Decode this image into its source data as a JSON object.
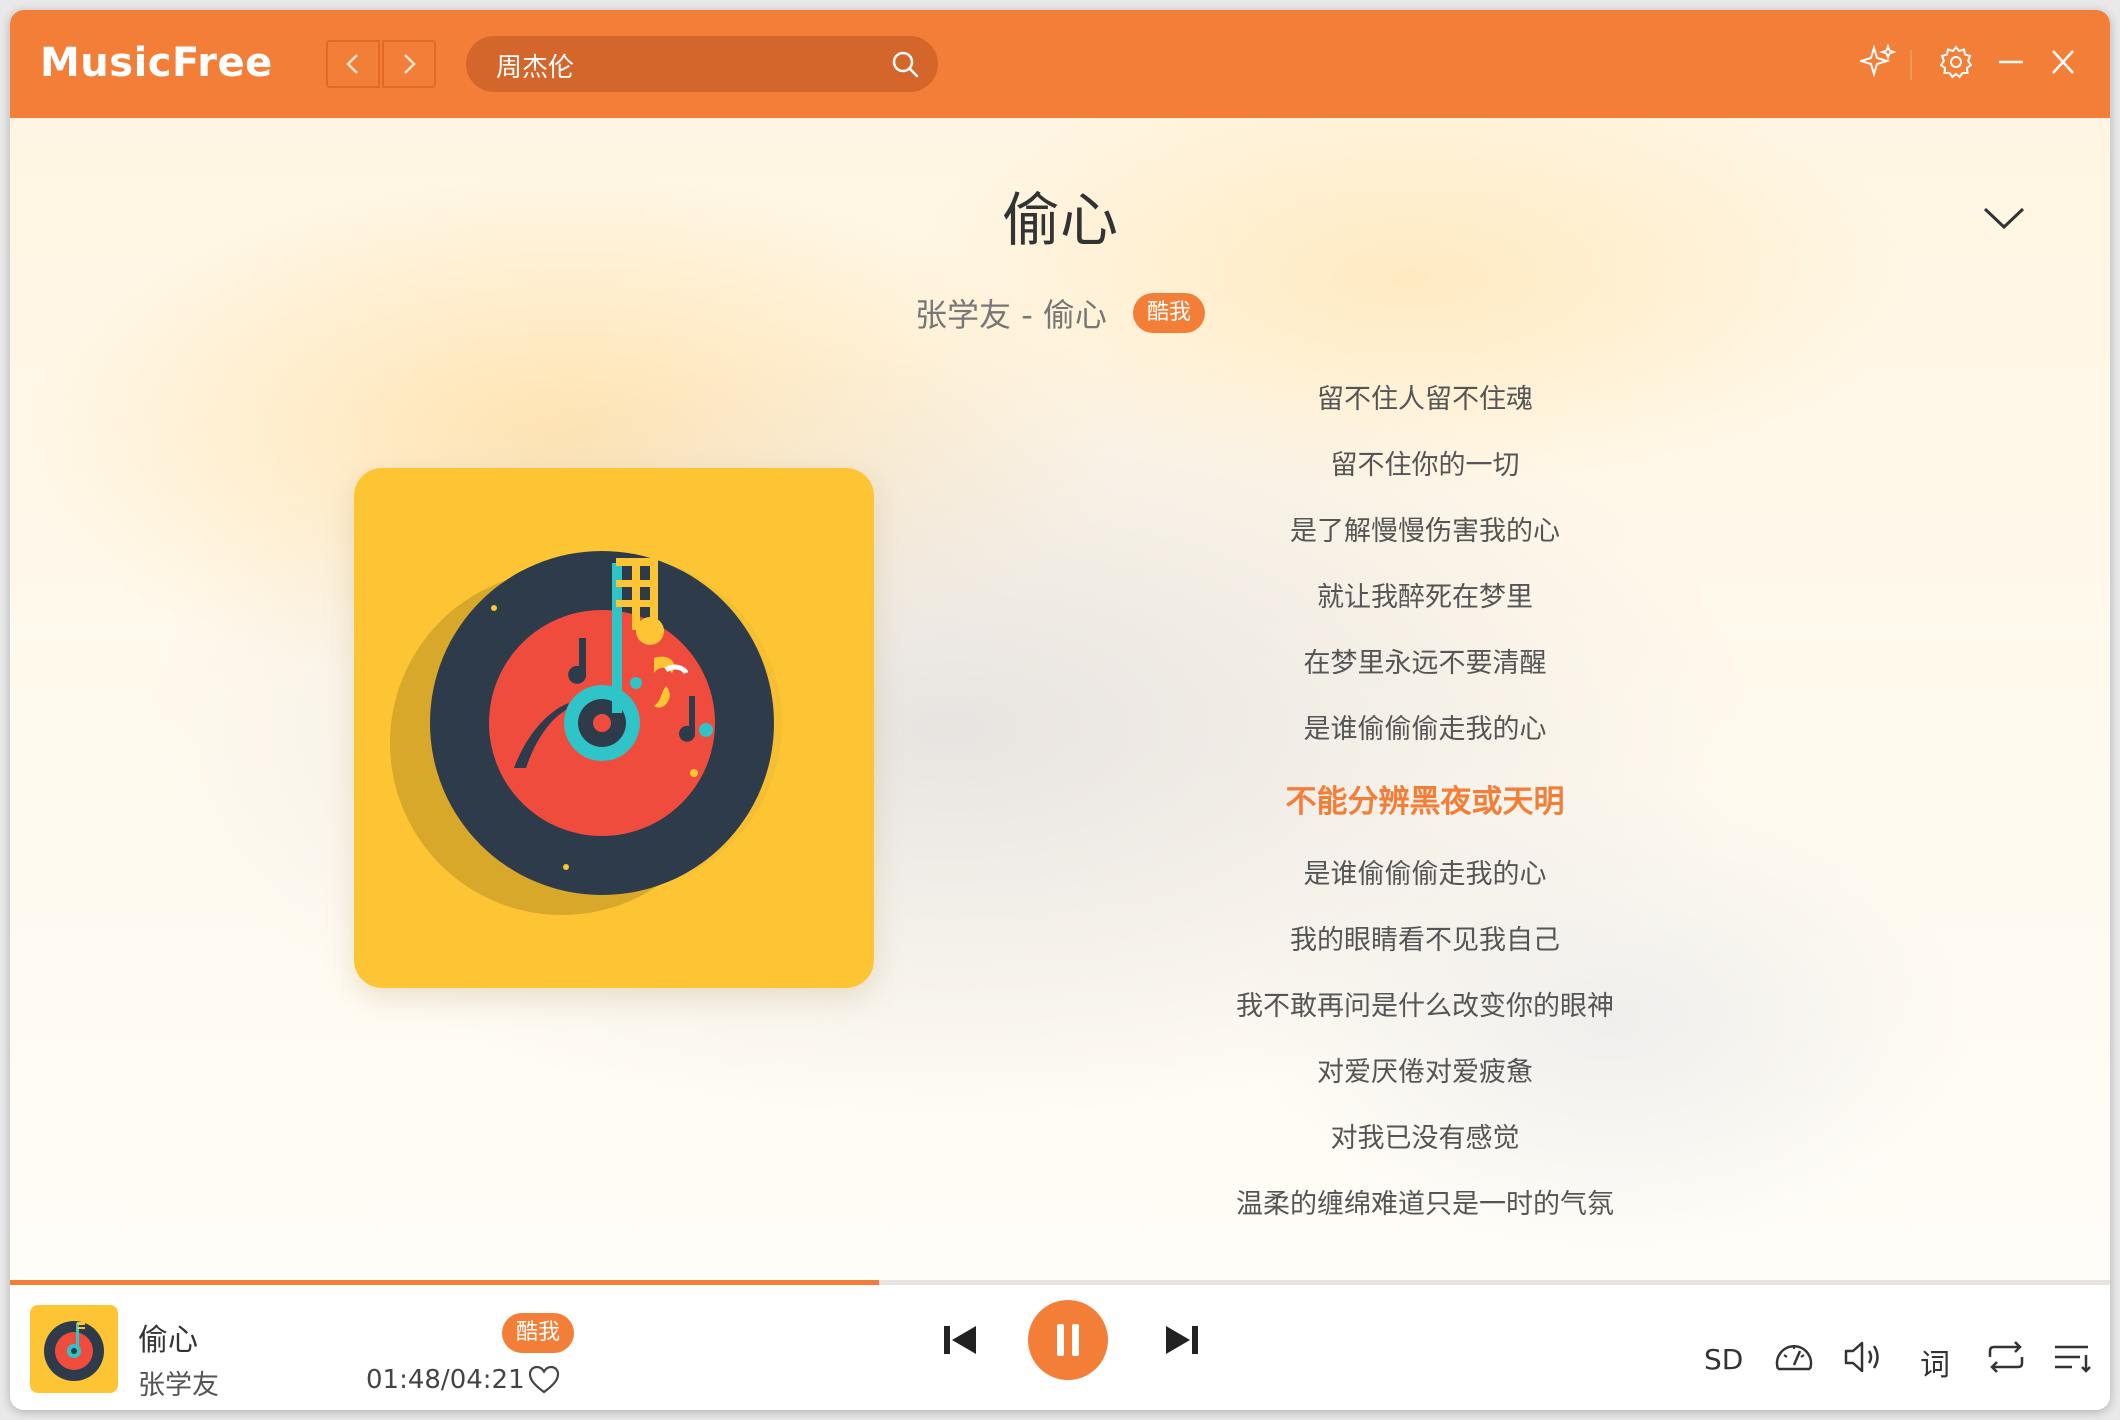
{
  "app": {
    "name": "MusicFree"
  },
  "search": {
    "value": "周杰伦"
  },
  "song": {
    "title": "偷心",
    "subtitle": "张学友 - 偷心",
    "source_badge": "酷我"
  },
  "lyrics": [
    "留不住人留不住魂",
    "留不住你的一切",
    "是了解慢慢伤害我的心",
    "就让我醉死在梦里",
    "在梦里永远不要清醒",
    "是谁偷偷偷走我的心",
    "不能分辨黑夜或天明",
    "是谁偷偷偷走我的心",
    "我的眼睛看不见我自己",
    "我不敢再问是什么改变你的眼神",
    "对爱厌倦对爱疲惫",
    "对我已没有感觉",
    "温柔的缠绵难道只是一时的气氛"
  ],
  "current_lyric_index": 6,
  "player": {
    "title": "偷心",
    "artist": "张学友",
    "source_badge": "酷我",
    "time": "01:48/04:21",
    "progress": 0.414,
    "quality": "SD",
    "lyric_toggle": "词"
  },
  "colors": {
    "accent": "#f37e38",
    "album_bg": "#fdc534",
    "disc": "#2d3b4b",
    "disc_label": "#f04c3e",
    "center": "#2ec4c8"
  },
  "icons": {
    "titlebar": [
      "chevron-left-icon",
      "chevron-right-icon",
      "search-icon",
      "sparkle-icon",
      "gear-icon",
      "minimize-icon",
      "close-icon"
    ],
    "player": [
      "previous-icon",
      "pause-icon",
      "next-icon",
      "heart-icon",
      "equalizer-icon",
      "volume-icon",
      "repeat-icon",
      "playlist-icon"
    ]
  }
}
